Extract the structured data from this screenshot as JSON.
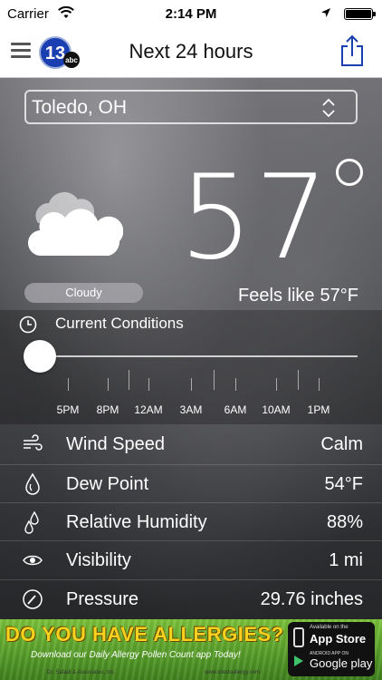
{
  "status_bar": {
    "carrier": "Carrier",
    "time": "2:14 PM"
  },
  "nav": {
    "title": "Next 24 hours",
    "logo_number": "13",
    "logo_network": "abc"
  },
  "location": {
    "value": "Toledo, OH"
  },
  "current": {
    "condition": "Cloudy",
    "temperature": "57",
    "feels_like_label": "Feels like",
    "feels_like_value": "57°F"
  },
  "timeline": {
    "label": "Current Conditions",
    "slider_position": 0,
    "ticks": [
      "5PM",
      "8PM",
      "12AM",
      "3AM",
      "6AM",
      "10AM",
      "1PM"
    ]
  },
  "details": [
    {
      "icon": "wind-icon",
      "label": "Wind Speed",
      "value": "Calm"
    },
    {
      "icon": "dew-point-icon",
      "label": "Dew Point",
      "value": "54°F"
    },
    {
      "icon": "humidity-icon",
      "label": "Relative Humidity",
      "value": "88%"
    },
    {
      "icon": "visibility-icon",
      "label": "Visibility",
      "value": "1 mi"
    },
    {
      "icon": "pressure-icon",
      "label": "Pressure",
      "value": "29.76 inches"
    }
  ],
  "ad": {
    "headline": "DO YOU HAVE ALLERGIES?",
    "subline": "Download our Daily Allergy Pollen Count app Today!",
    "credit": "Dr. Safadi & Associates, Inc.",
    "url": "www.toledoallergy.com",
    "appstore_small": "Available on the",
    "appstore_big": "App Store",
    "googleplay_small": "ANDROID APP ON",
    "googleplay_big": "Google play"
  },
  "colors": {
    "accent": "#1a3fb0",
    "ad_green": "#5aa02a",
    "ad_yellow": "#f7d21e"
  }
}
